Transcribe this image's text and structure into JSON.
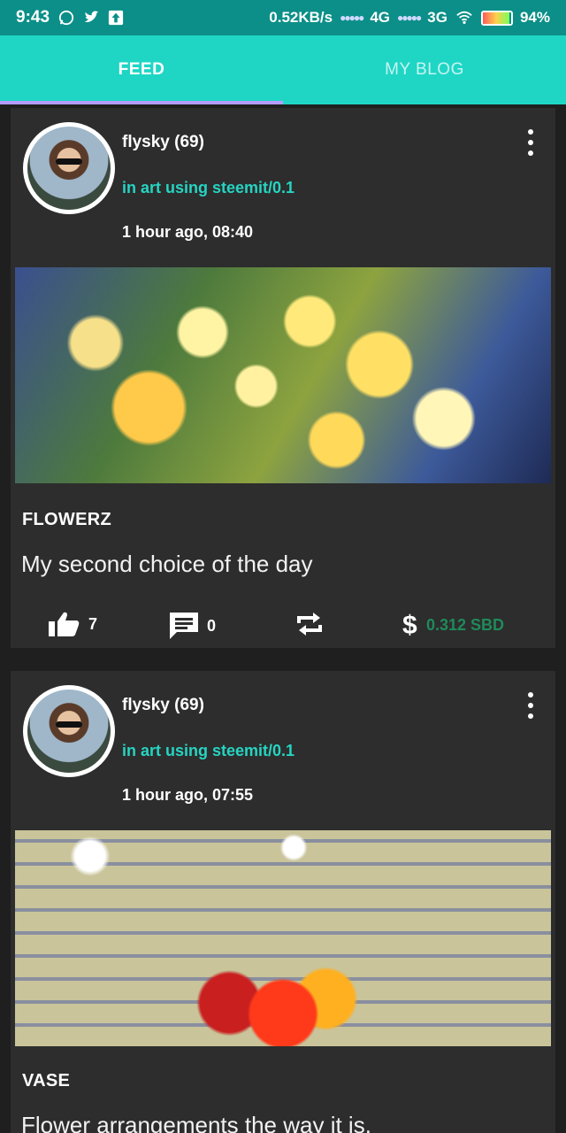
{
  "status_bar": {
    "time": "9:43",
    "net_speed": "0.52KB/s",
    "sim1": "4G",
    "sim2": "3G",
    "battery": "94%",
    "battery_level": 0.94,
    "bg_color": "#0b8f88"
  },
  "tabs": [
    {
      "label": "FEED",
      "active": true
    },
    {
      "label": "MY BLOG",
      "active": false
    }
  ],
  "accent_color": "#1fd6c5",
  "posts": [
    {
      "author": "flysky (69)",
      "category": "in art using steemit/0.1",
      "time": "1 hour ago, 08:40",
      "image": "flowers-image",
      "title": "FLOWERZ",
      "summary": "My second choice of the day",
      "likes": "7",
      "comments": "0",
      "payout": "0.312 SBD"
    },
    {
      "author": "flysky (69)",
      "category": "in art using steemit/0.1",
      "time": "1 hour ago, 07:55",
      "image": "vase-image",
      "title": "VASE",
      "summary": "Flower arrangements the way it is."
    }
  ]
}
